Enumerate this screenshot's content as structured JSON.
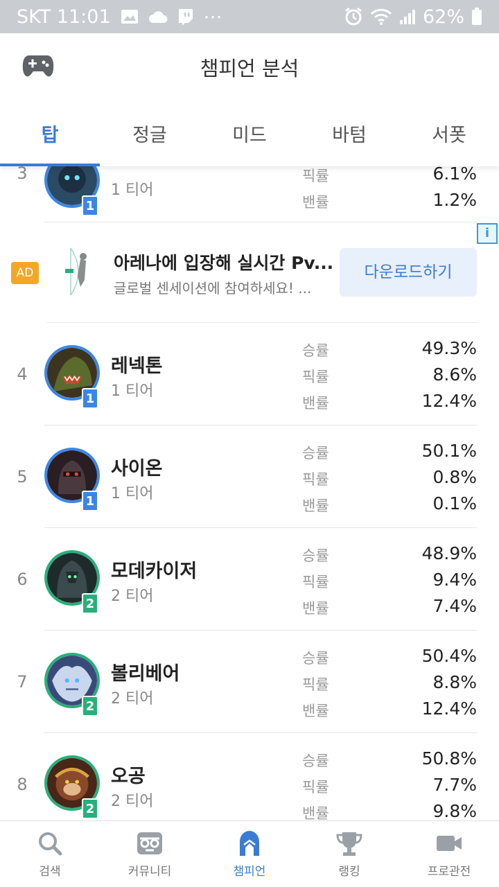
{
  "status_bar": {
    "carrier_time": "SKT 11:01",
    "icons_left": [
      "image-icon",
      "cloud-icon",
      "twitch-icon",
      "more-dots-icon"
    ],
    "icons_right": [
      "alarm-icon",
      "wifi-icon",
      "signal-icon",
      "battery-icon"
    ],
    "battery": "62%"
  },
  "header": {
    "title": "챔피언 분석",
    "left_icon": "gamepad-icon"
  },
  "tabs": [
    {
      "label": "탑",
      "active": true
    },
    {
      "label": "정글",
      "active": false
    },
    {
      "label": "미드",
      "active": false
    },
    {
      "label": "바텀",
      "active": false
    },
    {
      "label": "서폿",
      "active": false
    }
  ],
  "stat_labels": {
    "win": "승률",
    "pick": "픽률",
    "ban": "밴률"
  },
  "partial_row": {
    "rank": "3",
    "tier_badge": "1",
    "tier": "1 티어",
    "pick": "6.1%",
    "ban": "1.2%"
  },
  "ad": {
    "badge": "AD",
    "info": "i",
    "title": "아레나에 입장해 실시간 Pv...",
    "description": "글로벌 센세이션에 참여하세요! ...",
    "cta": "다운로드하기"
  },
  "champions": [
    {
      "rank": "4",
      "name": "레넥톤",
      "tier_badge": "1",
      "tier": "1 티어",
      "win": "49.3%",
      "pick": "8.6%",
      "ban": "12.4%"
    },
    {
      "rank": "5",
      "name": "사이온",
      "tier_badge": "1",
      "tier": "1 티어",
      "win": "50.1%",
      "pick": "0.8%",
      "ban": "0.1%"
    },
    {
      "rank": "6",
      "name": "모데카이저",
      "tier_badge": "2",
      "tier": "2 티어",
      "win": "48.9%",
      "pick": "9.4%",
      "ban": "7.4%"
    },
    {
      "rank": "7",
      "name": "볼리베어",
      "tier_badge": "2",
      "tier": "2 티어",
      "win": "50.4%",
      "pick": "8.8%",
      "ban": "12.4%"
    },
    {
      "rank": "8",
      "name": "오공",
      "tier_badge": "2",
      "tier": "2 티어",
      "win": "50.8%",
      "pick": "7.7%",
      "ban": "9.8%"
    }
  ],
  "bottom_nav": [
    {
      "label": "검색",
      "icon": "search-icon",
      "active": false
    },
    {
      "label": "커뮤니티",
      "icon": "community-icon",
      "active": false
    },
    {
      "label": "챔피언",
      "icon": "champion-helmet-icon",
      "active": true
    },
    {
      "label": "랭킹",
      "icon": "trophy-icon",
      "active": false
    },
    {
      "label": "프로관전",
      "icon": "video-camera-icon",
      "active": false
    }
  ],
  "colors": {
    "accent": "#3a7bd5",
    "tier1": "#3a86e8",
    "tier2": "#27b07a",
    "ad_badge": "#f5a623"
  }
}
